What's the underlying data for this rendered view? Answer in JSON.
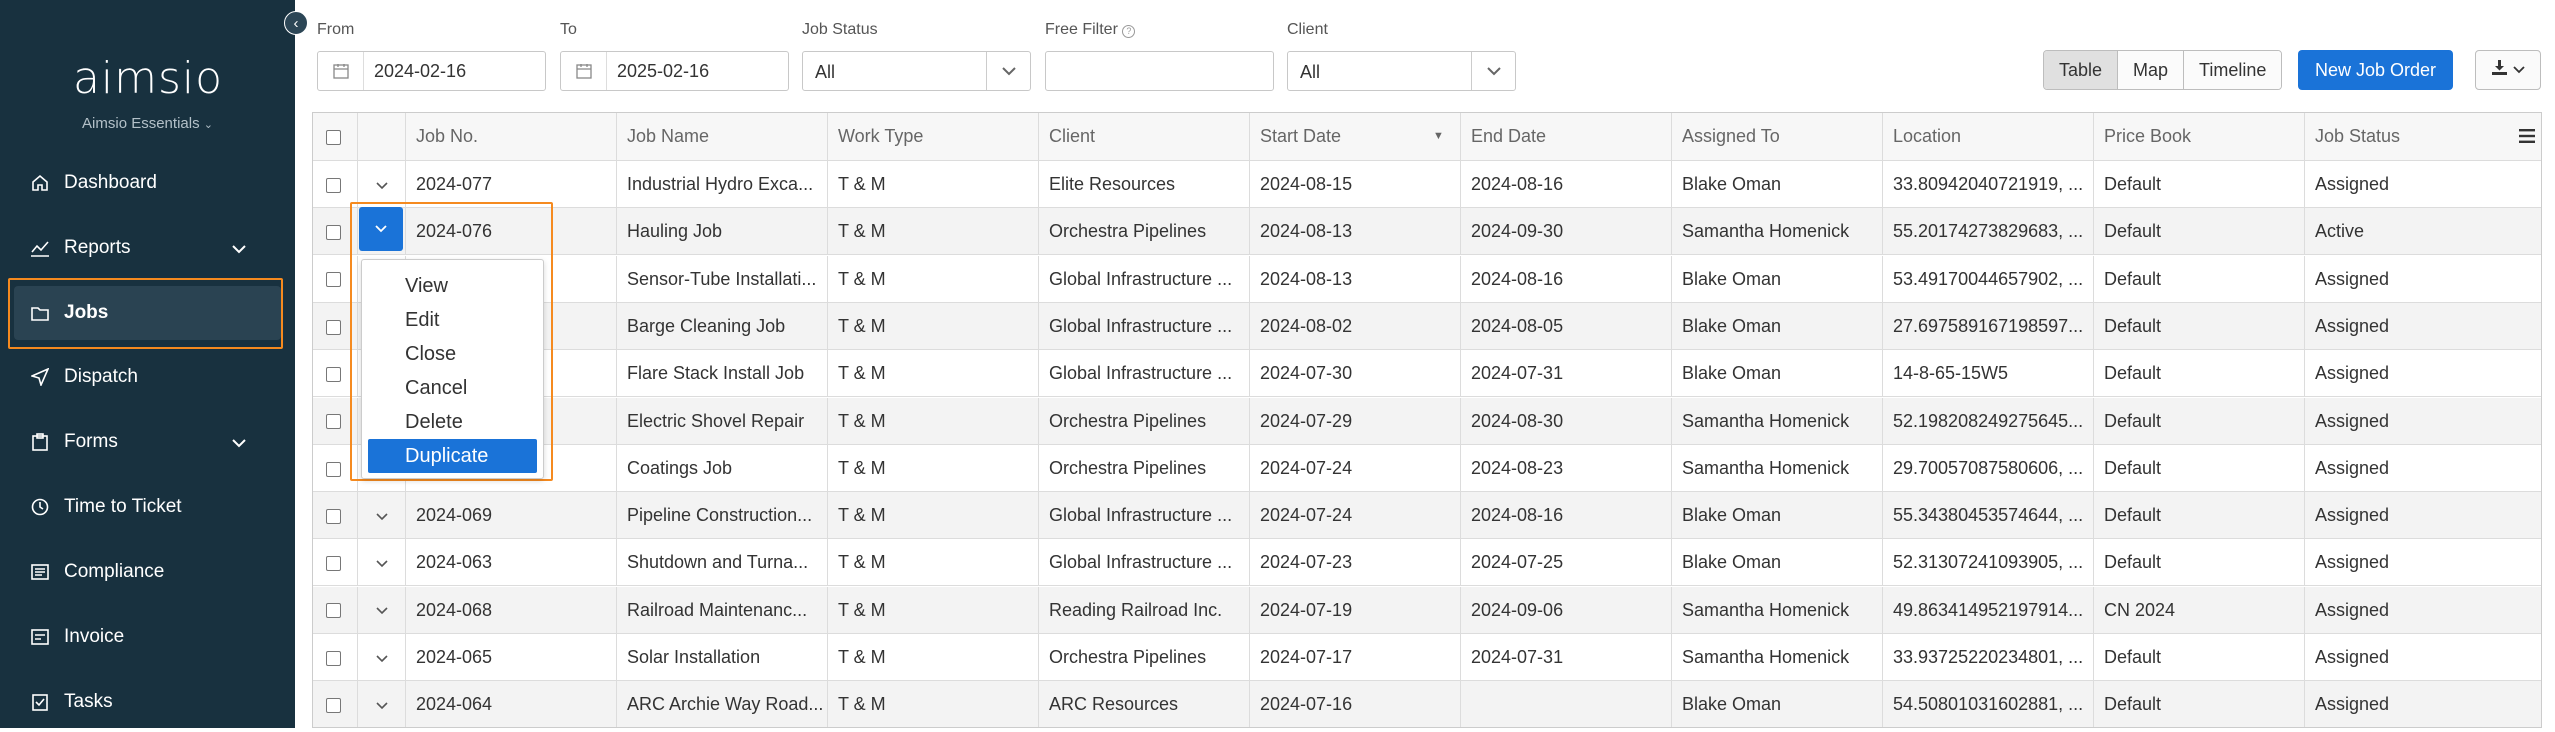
{
  "sidebar": {
    "logo": "aimsio",
    "subbrand": "Aimsio Essentials",
    "items": [
      {
        "label": "Dashboard",
        "icon": "home-icon"
      },
      {
        "label": "Reports",
        "icon": "chart-icon"
      },
      {
        "label": "Jobs",
        "icon": "folder-icon"
      },
      {
        "label": "Dispatch",
        "icon": "send-icon"
      },
      {
        "label": "Forms",
        "icon": "clipboard-icon"
      },
      {
        "label": "Time to Ticket",
        "icon": "clock-icon"
      },
      {
        "label": "Compliance",
        "icon": "list-icon"
      },
      {
        "label": "Invoice",
        "icon": "invoice-icon"
      },
      {
        "label": "Tasks",
        "icon": "tasks-icon"
      }
    ]
  },
  "filters": {
    "from_label": "From",
    "from_value": "2024-02-16",
    "to_label": "To",
    "to_value": "2025-02-16",
    "status_label": "Job Status",
    "status_value": "All",
    "free_label": "Free Filter",
    "free_value": "",
    "client_label": "Client",
    "client_value": "All"
  },
  "toolbar": {
    "views": [
      "Table",
      "Map",
      "Timeline"
    ],
    "active_view": "Table",
    "new_job_label": "New Job Order"
  },
  "columns": [
    "Job No.",
    "Job Name",
    "Work Type",
    "Client",
    "Start Date",
    "End Date",
    "Assigned To",
    "Location",
    "Price Book",
    "Job Status"
  ],
  "rows": [
    [
      "2024-077",
      "Industrial Hydro Exca...",
      "T & M",
      "Elite Resources",
      "2024-08-15",
      "2024-08-16",
      "Blake Oman",
      "33.80942040721919, ...",
      "Default",
      "Assigned"
    ],
    [
      "2024-076",
      "Hauling Job",
      "T & M",
      "Orchestra Pipelines",
      "2024-08-13",
      "2024-09-30",
      "Samantha Homenick",
      "55.20174273829683, ...",
      "Default",
      "Active"
    ],
    [
      "",
      "Sensor-Tube Installati...",
      "T & M",
      "Global Infrastructure ...",
      "2024-08-13",
      "2024-08-16",
      "Blake Oman",
      "53.49170044657902, ...",
      "Default",
      "Assigned"
    ],
    [
      "",
      "Barge Cleaning Job",
      "T & M",
      "Global Infrastructure ...",
      "2024-08-02",
      "2024-08-05",
      "Blake Oman",
      "27.697589167198597...",
      "Default",
      "Assigned"
    ],
    [
      "",
      "Flare Stack Install Job",
      "T & M",
      "Global Infrastructure ...",
      "2024-07-30",
      "2024-07-31",
      "Blake Oman",
      "14-8-65-15W5",
      "Default",
      "Assigned"
    ],
    [
      "",
      "Electric Shovel Repair",
      "T & M",
      "Orchestra Pipelines",
      "2024-07-29",
      "2024-08-30",
      "Samantha Homenick",
      "52.198208249275645...",
      "Default",
      "Assigned"
    ],
    [
      "",
      "Coatings Job",
      "T & M",
      "Orchestra Pipelines",
      "2024-07-24",
      "2024-08-23",
      "Samantha Homenick",
      "29.70057087580606, ...",
      "Default",
      "Assigned"
    ],
    [
      "2024-069",
      "Pipeline Construction...",
      "T & M",
      "Global Infrastructure ...",
      "2024-07-24",
      "2024-08-16",
      "Blake Oman",
      "55.34380453574644, ...",
      "Default",
      "Assigned"
    ],
    [
      "2024-063",
      "Shutdown and Turna...",
      "T & M",
      "Global Infrastructure ...",
      "2024-07-23",
      "2024-07-25",
      "Blake Oman",
      "52.31307241093905, ...",
      "Default",
      "Assigned"
    ],
    [
      "2024-068",
      "Railroad Maintenanc...",
      "T & M",
      "Reading Railroad Inc.",
      "2024-07-19",
      "2024-09-06",
      "Samantha Homenick",
      "49.863414952197914...",
      "CN 2024",
      "Assigned"
    ],
    [
      "2024-065",
      "Solar Installation",
      "T & M",
      "Orchestra Pipelines",
      "2024-07-17",
      "2024-07-31",
      "Samantha Homenick",
      "33.93725220234801, ...",
      "Default",
      "Assigned"
    ],
    [
      "2024-064",
      "ARC Archie Way Road...",
      "T & M",
      "ARC Resources",
      "2024-07-16",
      "",
      "Blake Oman",
      "54.50801031602881, ...",
      "Default",
      "Assigned"
    ]
  ],
  "row_menu": [
    "View",
    "Edit",
    "Close",
    "Cancel",
    "Delete",
    "Duplicate"
  ],
  "row_menu_highlight": "Duplicate",
  "colors": {
    "sidebar": "#18313f",
    "primary": "#1a73d8",
    "highlight": "#f58a1f"
  }
}
